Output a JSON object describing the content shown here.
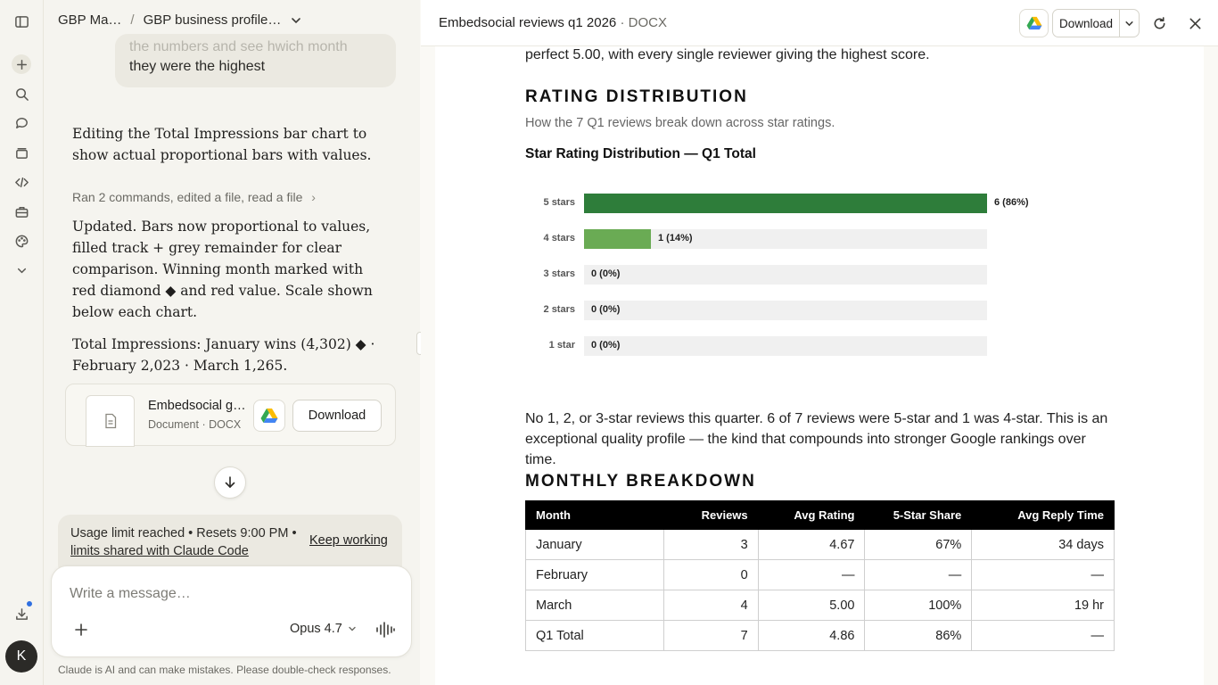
{
  "breadcrumb": {
    "project": "GBP Ma…",
    "separator": "/",
    "chat_title": "GBP business profile…"
  },
  "chat": {
    "user_message_faded": "the numbers and see hwich month",
    "user_message": "they were the highest",
    "assistant_intro": "Editing the Total Impressions bar chart to show actual proportional bars with values.",
    "tool_summary": "Ran 2 commands, edited a file, read a file",
    "tool_chevron": "›",
    "assistant_update": "Updated. Bars now proportional to values, filled track + grey remainder for clear comparison. Winning month marked with red diamond ◆ and red value. Scale shown below each chart.",
    "assistant_result": "Total Impressions: January wins (4,302) ◆ · February 2,023 · March 1,265.",
    "file_card": {
      "name": "Embedsocial g…",
      "meta": "Document · DOCX",
      "download_label": "Download"
    }
  },
  "usage_banner": {
    "text": "Usage limit reached • Resets 9:00 PM •",
    "link": "limits shared with Claude Code",
    "action": "Keep working"
  },
  "composer": {
    "placeholder": "Write a message…",
    "model": "Opus 4.7"
  },
  "disclaimer": "Claude is AI and can make mistakes. Please double-check responses.",
  "avatar_initial": "K",
  "viewer": {
    "title": "Embedsocial reviews q1 2026",
    "type_sep": " · ",
    "type": "DOCX",
    "download_label": "Download"
  },
  "document": {
    "intro_tail": "perfect 5.00, with every single reviewer giving the highest score.",
    "rating_heading": "RATING DISTRIBUTION",
    "rating_sub": "How the 7 Q1 reviews break down across star ratings.",
    "chart_title": "Star Rating Distribution — Q1 Total",
    "summary": "No 1, 2, or 3-star reviews this quarter. 6 of 7 reviews were 5-star and 1 was 4-star. This is an exceptional quality profile — the kind that compounds into stronger Google rankings over time.",
    "monthly_heading": "MONTHLY BREAKDOWN",
    "table": {
      "headers": [
        "Month",
        "Reviews",
        "Avg Rating",
        "5-Star Share",
        "Avg Reply Time"
      ],
      "rows": [
        [
          "January",
          "3",
          "4.67",
          "67%",
          "34 days"
        ],
        [
          "February",
          "0",
          "—",
          "—",
          "—"
        ],
        [
          "March",
          "4",
          "5.00",
          "100%",
          "19 hr"
        ],
        [
          "Q1 Total",
          "7",
          "4.86",
          "86%",
          "—"
        ]
      ]
    }
  },
  "chart_data": {
    "type": "bar",
    "orientation": "horizontal",
    "title": "Star Rating Distribution — Q1 Total",
    "categories": [
      "5 stars",
      "4 stars",
      "3 stars",
      "2 stars",
      "1 star"
    ],
    "values": [
      6,
      1,
      0,
      0,
      0
    ],
    "value_labels": [
      "6 (86%)",
      "1 (14%)",
      "0 (0%)",
      "0 (0%)",
      "0 (0%)"
    ],
    "max": 7,
    "colors": [
      "#2e7d3a",
      "#6aab54",
      "#6aab54",
      "#6aab54",
      "#6aab54"
    ],
    "track_color": "#f0f0f0"
  }
}
